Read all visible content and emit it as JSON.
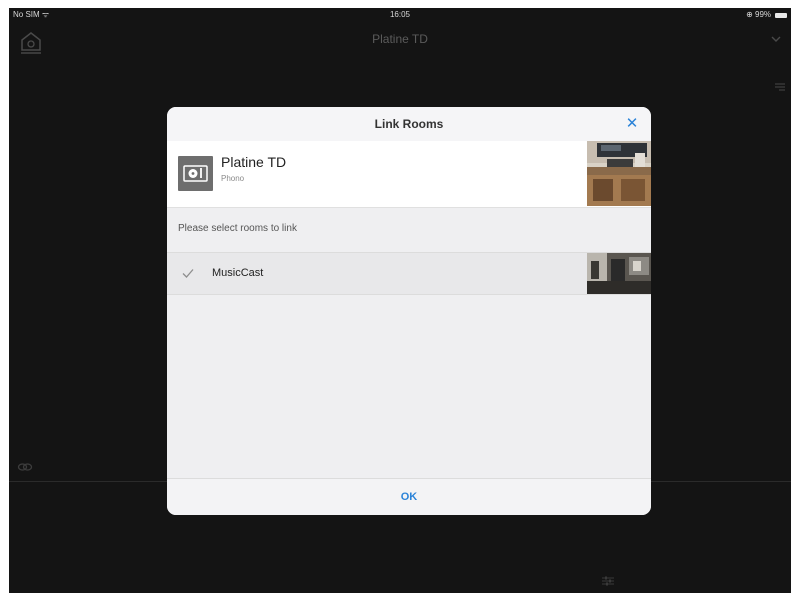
{
  "status_bar": {
    "carrier": "No SIM ᯤ",
    "time": "16:05",
    "battery_text": "⊕ 99%"
  },
  "app_header": {
    "room_title": "Platine TD",
    "home_icon": "home-speaker-icon",
    "chevron_icon": "chevron-down-icon"
  },
  "modal": {
    "title": "Link Rooms",
    "close_label": "✕",
    "source": {
      "name": "Platine TD",
      "input": "Phono",
      "icon": "turntable-icon"
    },
    "instruction": "Please select rooms to link",
    "rooms": [
      {
        "name": "MusicCast",
        "checked": true
      }
    ],
    "ok_label": "OK"
  },
  "colors": {
    "accent": "#2b83d8",
    "background": "#141414",
    "modal_bg": "#efeff1"
  }
}
